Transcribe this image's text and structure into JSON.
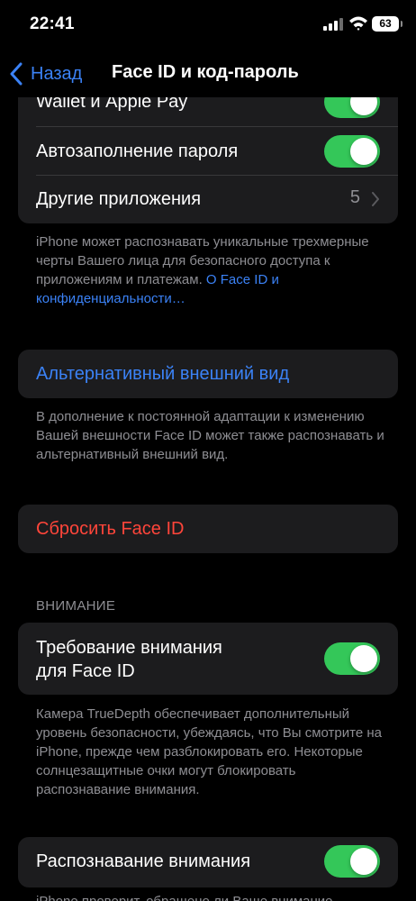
{
  "status_bar": {
    "time": "22:41",
    "battery": "63",
    "icons": [
      "signal-icon",
      "wifi-icon",
      "battery-icon"
    ]
  },
  "nav": {
    "back_label": "Назад",
    "title": "Face ID и код-пароль"
  },
  "group1": {
    "rows": [
      {
        "label": "Wallet и Apple Pay",
        "toggle": true
      },
      {
        "label": "Автозаполнение пароля",
        "toggle": true
      },
      {
        "label": "Другие приложения",
        "value": "5"
      }
    ]
  },
  "footnote1": {
    "text": "iPhone может распознавать уникальные трехмерные черты Вашего лица для безопасного доступа к приложениям и платежам. ",
    "link": "О Face ID и конфиденциальности…"
  },
  "alt_appearance": {
    "label": "Альтернативный внешний вид",
    "footnote": "В дополнение к постоянной адаптации к изменению Вашей внешности Face ID может также распознавать и альтернативный внешний вид."
  },
  "reset": {
    "label": "Сбросить Face ID"
  },
  "attention": {
    "header": "ВНИМАНИЕ",
    "require_label_line1": "Требование внимания",
    "require_label_line2": "для Face ID",
    "require_toggle": true,
    "footnote": "Камера TrueDepth обеспечивает дополнительный уровень безопасности, убеждаясь, что Вы смотрите на iPhone, прежде чем разблокировать его. Некоторые солнцезащитные очки могут блокировать распознавание внимания.",
    "aware_label": "Распознавание внимания",
    "aware_toggle": true,
    "partial_footnote": "iPhone проверит, обращено ли Ваше внимание"
  },
  "colors": {
    "accent": "#3b82f6",
    "destructive": "#ff453a",
    "toggle_on": "#34c759",
    "cell_bg": "#1c1c1e",
    "secondary_text": "#8e8e93"
  }
}
